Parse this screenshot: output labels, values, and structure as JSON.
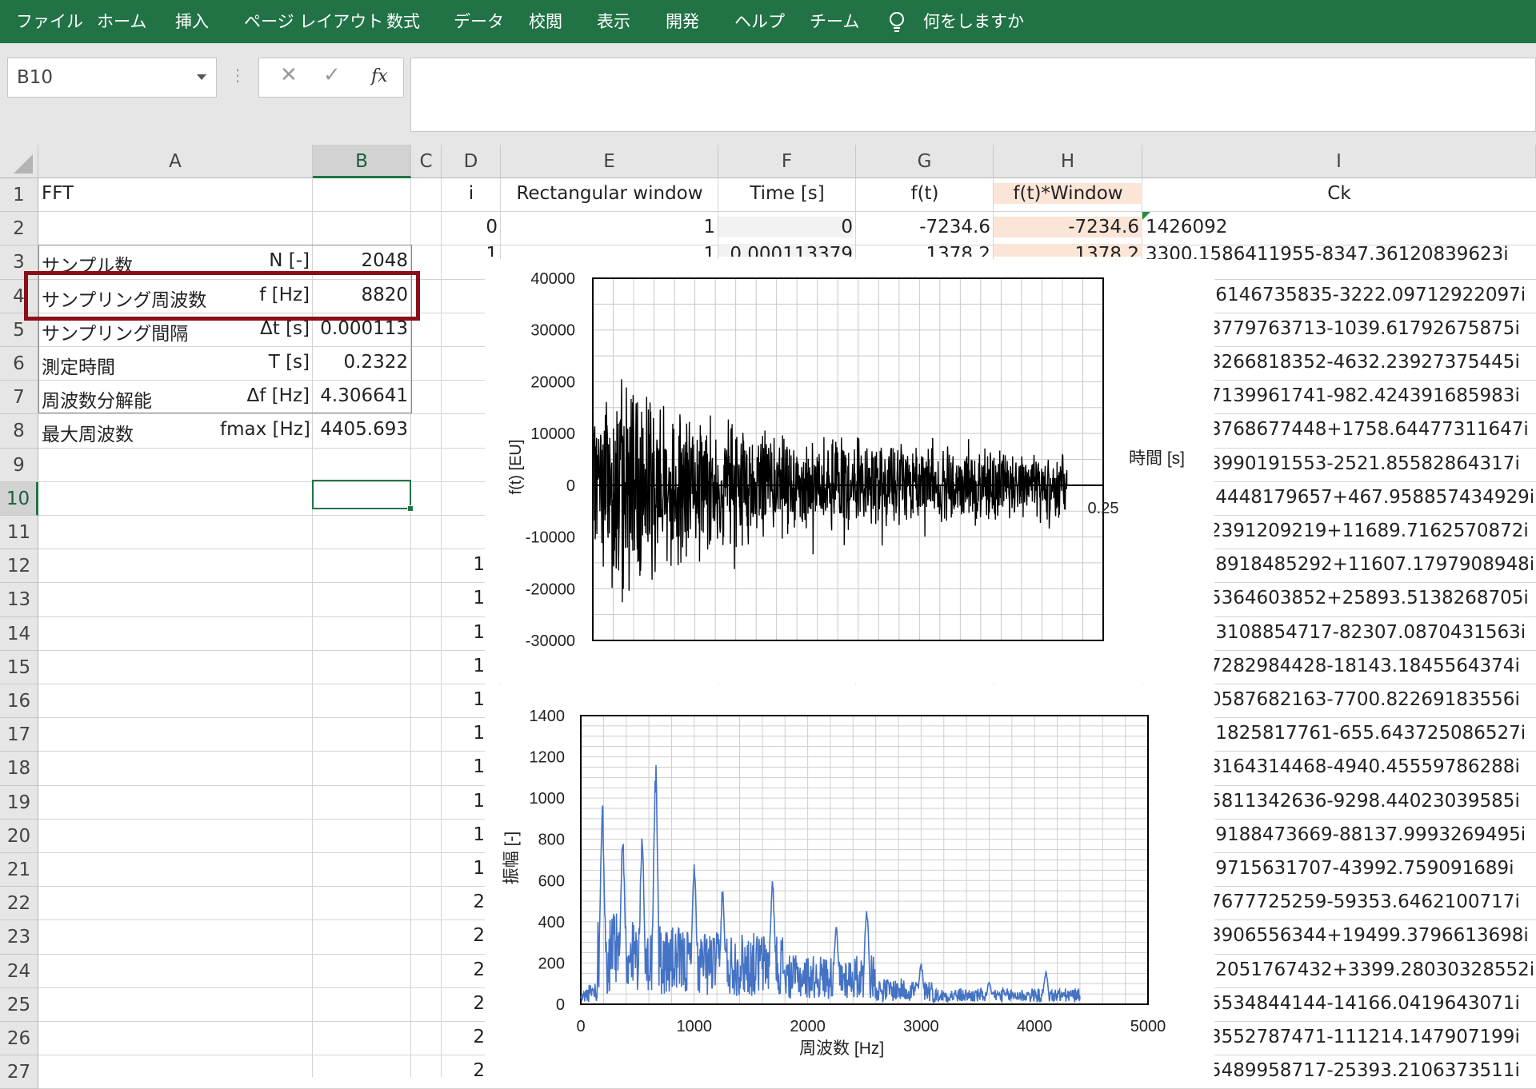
{
  "ribbon": {
    "tabs": [
      "ファイル",
      "ホーム",
      "挿入",
      "ページ レイアウト",
      "数式",
      "データ",
      "校閲",
      "表示",
      "開発",
      "ヘルプ",
      "チーム"
    ],
    "tell_me": "何をしますか",
    "background_color": "#217346"
  },
  "formula_bar": {
    "name_box": "B10",
    "cancel_icon": "✕",
    "enter_icon": "✓",
    "function_icon": "fx",
    "formula": ""
  },
  "columns": [
    "A",
    "B",
    "C",
    "D",
    "E",
    "F",
    "G",
    "H",
    "I"
  ],
  "rows": [
    "1",
    "2",
    "3",
    "4",
    "5",
    "6",
    "7",
    "8",
    "9",
    "10",
    "11",
    "12",
    "13",
    "14",
    "15",
    "16",
    "17",
    "18",
    "19",
    "20",
    "21",
    "22",
    "23",
    "24",
    "25",
    "26",
    "27"
  ],
  "params": {
    "title": "FFT",
    "items": [
      {
        "label": "サンプル数",
        "unit": "N [-]",
        "value": "2048"
      },
      {
        "label": "サンプリング周波数",
        "unit": "f [Hz]",
        "value": "8820"
      },
      {
        "label": "サンプリング間隔",
        "unit": "Δt [s]",
        "value": "0.000113"
      },
      {
        "label": "測定時間",
        "unit": "T [s]",
        "value": "0.2322"
      },
      {
        "label": "周波数分解能",
        "unit": "Δf [Hz]",
        "value": "4.306641"
      },
      {
        "label": "最大周波数",
        "unit": "fmax [Hz]",
        "value": "4405.693"
      }
    ]
  },
  "table": {
    "headers": [
      "i",
      "Rectangular window",
      "Time [s]",
      "f(t)",
      "f(t)*Window",
      "Ck"
    ],
    "row2": {
      "i": "0",
      "window": "1",
      "time": "0",
      "ft": "-7234.6",
      "ftw": "-7234.6",
      "ck": "1426092"
    },
    "row3": {
      "i": "1",
      "window": "1",
      "time": "0.000113379",
      "ft": "1378.2",
      "ftw": "1378.2",
      "ck": "3300.1586411955-8347.36120839623i"
    },
    "d_col_partial": [
      "1",
      "1",
      "1",
      "1",
      "1",
      "1",
      "1",
      "1",
      "1",
      "1",
      "2",
      "2",
      "2",
      "2",
      "2",
      "2"
    ],
    "ck_values": [
      ".6146735835-3222.09712922097i",
      "3779763713-1039.61792675875i",
      "3266818352-4632.23927375445i",
      "7139961741-982.424391685983i",
      "3768677448+1758.64477311647i",
      "3990191553-2521.85582864317i",
      ".4448179657+467.958857434929i",
      "2391209219+11689.7162570872i",
      ".8918485292+11607.1797908948i",
      "5364603852+25893.5138268705i",
      ".3108854717-82307.0870431563i",
      "7282984428-18143.1845564374i",
      "0587682163-7700.82269183556i",
      ".1825817761-655.643725086527i",
      "3164314468-4940.45559786288i",
      "5811342636-9298.44023039585i",
      ".9188473669-88137.9993269495i",
      ".9715631707-43992.759091689i",
      "7677725259-59353.6462100717i",
      "3906556344+19499.3796613698i",
      ".2051767432+3399.28030328552i",
      "5534844144-14166.0419643071i",
      "3552787471-111214.147907199i",
      "5489958717-25393.2106373511i"
    ]
  },
  "chart_data": [
    {
      "type": "line",
      "ylabel": "f(t) [EU]",
      "xlabel": "時間 [s]",
      "ylim": [
        -30000,
        40000
      ],
      "xlim": [
        0,
        0.25
      ],
      "yticks": [
        "40000",
        "30000",
        "20000",
        "10000",
        "0",
        "-10000",
        "-20000",
        "-30000"
      ],
      "xticks_visible": [
        "0.25"
      ],
      "grid": true,
      "color": "#000000",
      "signal_end_s": 0.2322,
      "envelope": {
        "x": [
          0,
          0.01,
          0.03,
          0.06,
          0.1,
          0.15,
          0.2322
        ],
        "amplitude": [
          14000,
          24000,
          20000,
          14000,
          10000,
          9000,
          7000
        ]
      }
    },
    {
      "type": "line",
      "ylabel": "振幅 [-]",
      "xlabel": "周波数 [Hz]",
      "ylim": [
        0,
        1400
      ],
      "xlim": [
        0,
        5000
      ],
      "yticks": [
        "1400",
        "1200",
        "1000",
        "800",
        "600",
        "400",
        "200",
        "0"
      ],
      "xticks": [
        "0",
        "1000",
        "2000",
        "3000",
        "4000",
        "5000"
      ],
      "grid": true,
      "color": "#4472c4",
      "fmax_hz": 4405.693,
      "peaks": [
        {
          "x": 190,
          "y": 1000
        },
        {
          "x": 370,
          "y": 840
        },
        {
          "x": 540,
          "y": 820
        },
        {
          "x": 660,
          "y": 1180
        },
        {
          "x": 1000,
          "y": 690
        },
        {
          "x": 1250,
          "y": 580
        },
        {
          "x": 1690,
          "y": 630
        },
        {
          "x": 2250,
          "y": 390
        },
        {
          "x": 2520,
          "y": 480
        },
        {
          "x": 3000,
          "y": 200
        },
        {
          "x": 3600,
          "y": 110
        },
        {
          "x": 4100,
          "y": 160
        }
      ]
    }
  ]
}
